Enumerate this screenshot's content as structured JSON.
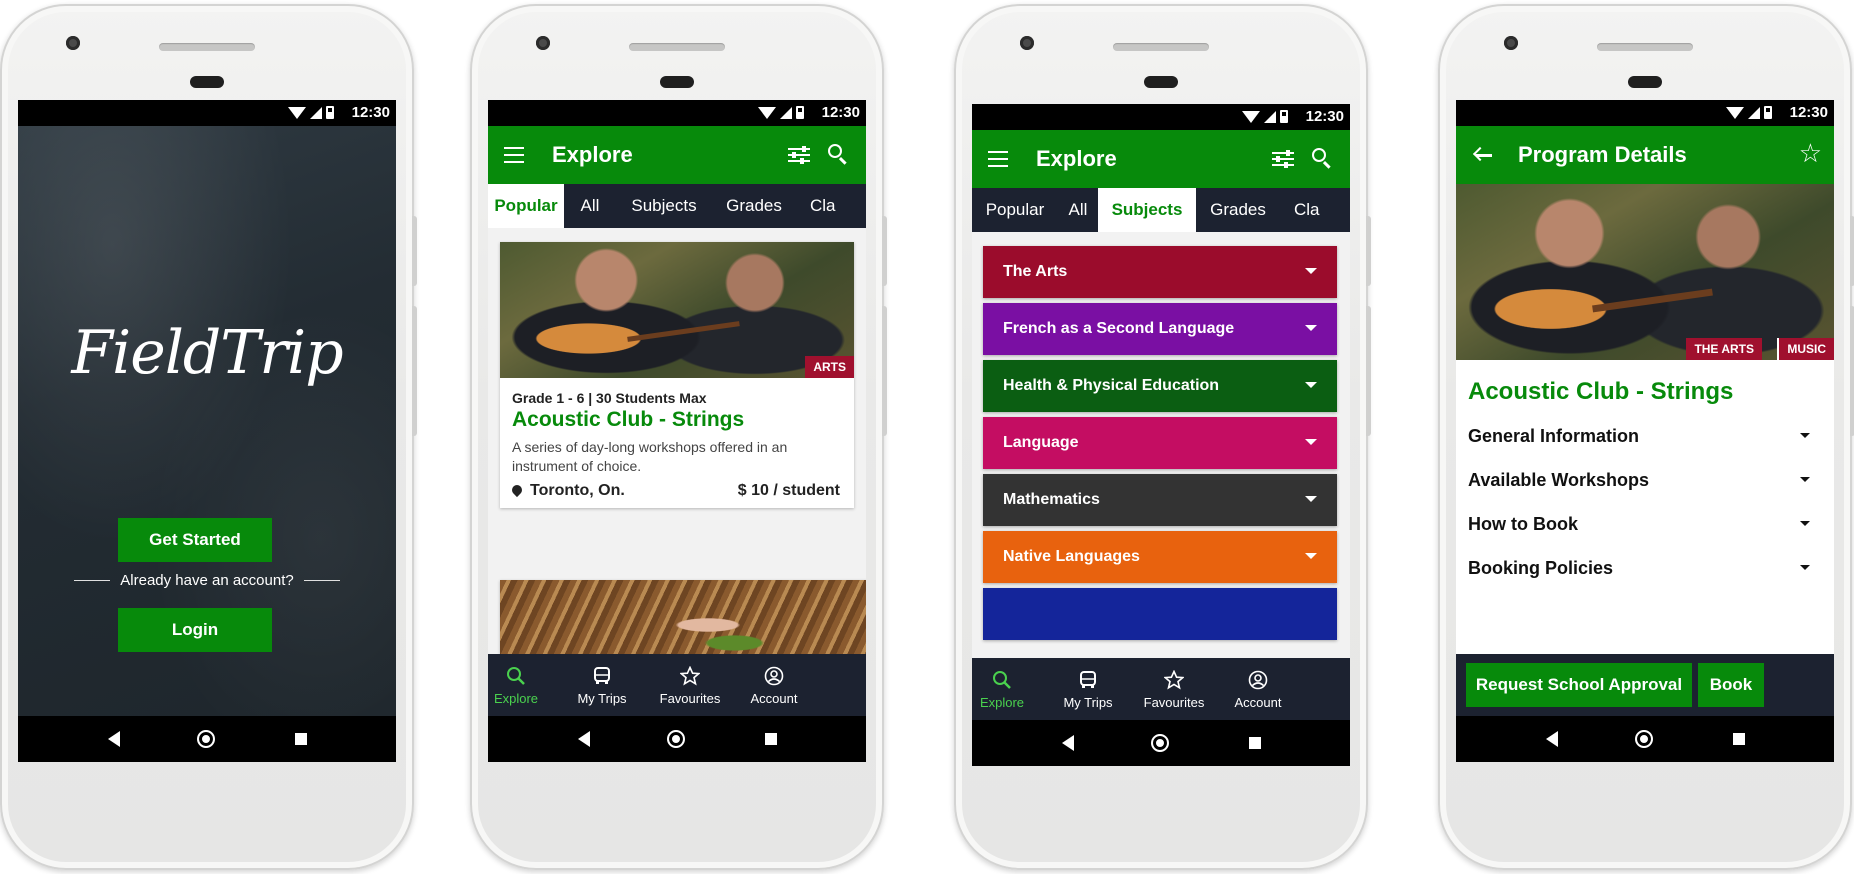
{
  "status_time": "12:30",
  "screen1": {
    "logo": "FieldTrip",
    "get_started": "Get Started",
    "already": "Already have an account?",
    "login": "Login"
  },
  "explore": {
    "title": "Explore",
    "tabs": [
      "Popular",
      "All",
      "Subjects",
      "Grades",
      "Cla"
    ],
    "card": {
      "meta": "Grade 1 - 6 | 30 Students Max",
      "title": "Acoustic Club - Strings",
      "badge": "ARTS",
      "description": "A series of day-long workshops offered in an instrument of choice.",
      "location": "Toronto, On.",
      "price": "$ 10 / student"
    }
  },
  "bottom_nav": [
    "Explore",
    "My Trips",
    "Favourites",
    "Account"
  ],
  "subjects": [
    {
      "label": "The Arts",
      "color": "#9b0c2c"
    },
    {
      "label": "French as a Second Language",
      "color": "#7a0fa3"
    },
    {
      "label": "Health & Physical Education",
      "color": "#0b5e12"
    },
    {
      "label": "Language",
      "color": "#c40d62"
    },
    {
      "label": "Mathematics",
      "color": "#333333"
    },
    {
      "label": "Native Languages",
      "color": "#e8620e"
    },
    {
      "label": "",
      "color": "#14259a"
    }
  ],
  "details": {
    "title": "Program Details",
    "program_title": "Acoustic Club - Strings",
    "badges": [
      "THE ARTS",
      "MUSIC"
    ],
    "sections": [
      "General Information",
      "Available Workshops",
      "How to Book",
      "Booking Policies"
    ],
    "request_button": "Request School Approval",
    "book_button": "Book"
  },
  "colors": {
    "brand_green": "#078a0b",
    "nav_dark": "#1c2230",
    "active_nav": "#4ad14e",
    "badge_red": "#a0102e"
  },
  "icons": [
    "menu-icon",
    "filter-icon",
    "search-icon",
    "back-arrow-icon",
    "star-icon",
    "explore-icon",
    "bus-icon",
    "star-outline-icon",
    "account-icon",
    "location-pin-icon"
  ]
}
